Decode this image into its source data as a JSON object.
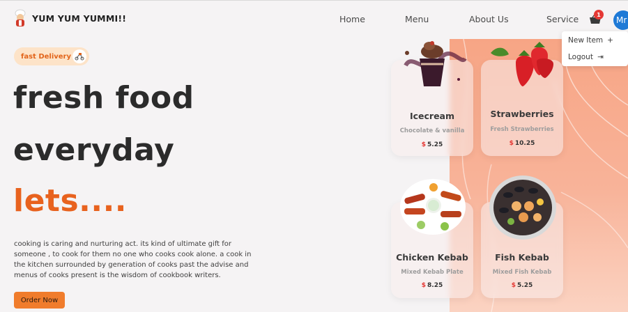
{
  "brand": {
    "name": "YUM YUM YUMMI!!"
  },
  "nav": {
    "items": [
      "Home",
      "Menu",
      "About Us",
      "Service"
    ]
  },
  "cart": {
    "count": "1"
  },
  "user": {
    "avatar_text": "Mr"
  },
  "user_menu": {
    "items": [
      {
        "label": "New Item",
        "icon": "plus-icon",
        "icon_glyph": "+"
      },
      {
        "label": "Logout",
        "icon": "logout-icon",
        "icon_glyph": "⇥"
      }
    ]
  },
  "hero": {
    "badge": "fast Delivery",
    "lines": [
      "fresh food",
      "everyday",
      "lets...."
    ],
    "accent_color": "#e8621e",
    "description": "cooking is caring and nurturing act. its kind of ultimate gift for someone , to cook for them no one who cooks cook alone. a cook in the kitchen surrounded by generation of cooks past the advise and menus of cooks present is the wisdom of cookbook writers.",
    "cta": "Order Now"
  },
  "menu_cards": [
    {
      "name": "Icecream",
      "subtitle": "Chocolate & vanilla",
      "currency": "$",
      "price": "5.25"
    },
    {
      "name": "Strawberries",
      "subtitle": "Fresh Strawberries",
      "currency": "$",
      "price": "10.25"
    },
    {
      "name": "Chicken Kebab",
      "subtitle": "Mixed Kebab Plate",
      "currency": "$",
      "price": "8.25"
    },
    {
      "name": "Fish Kebab",
      "subtitle": "Mixed Fish Kebab",
      "currency": "$",
      "price": "5.25"
    }
  ]
}
